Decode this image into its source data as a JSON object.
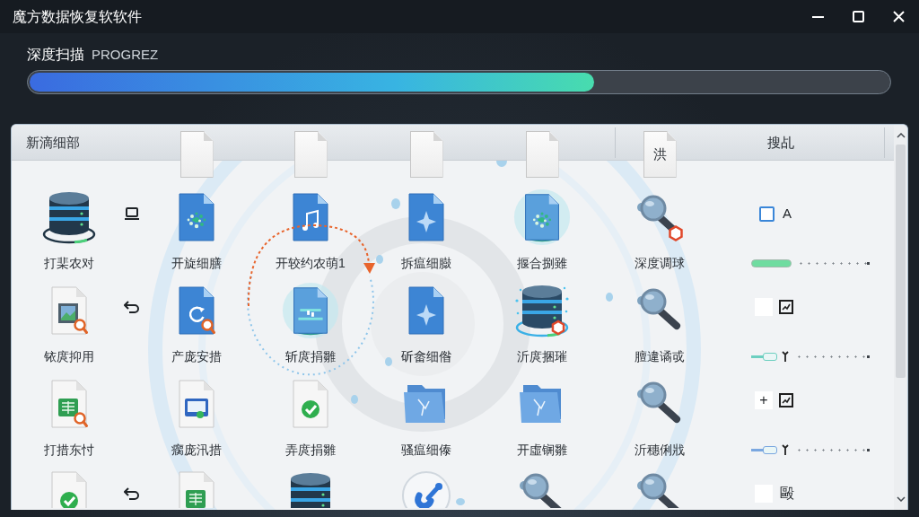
{
  "window": {
    "title": "魔方数据恢复软软件"
  },
  "scan": {
    "label": "深度扫描",
    "tag": "PROGREZ",
    "level": 0.657
  },
  "panel": {
    "title": "新滴细部",
    "file_tabs": [
      {
        "kind": "blank"
      },
      {
        "kind": "blank"
      },
      {
        "kind": "blank"
      },
      {
        "kind": "blank"
      },
      {
        "kind": "lettered",
        "label": "洪"
      }
    ],
    "column_label": "搜乩",
    "rows": [
      {
        "items": [
          {
            "kind": "database",
            "label": "打棐农对"
          },
          {
            "kind": "sparkle-doc",
            "label": "开旋细膳"
          },
          {
            "kind": "music-doc",
            "label": "开较约农萌1"
          },
          {
            "kind": "star-doc",
            "label": "拆瘟细臌"
          },
          {
            "kind": "sparkle-doc",
            "glow": true,
            "label": "揠合捌雖"
          },
          {
            "kind": "magnifier",
            "tag": true,
            "label": "深度调球"
          }
        ],
        "aside": {
          "kind": "laptop"
        },
        "controls": {
          "toggle": {
            "kind": "checkbox",
            "checked": false,
            "label": "A"
          },
          "slider": {
            "kind": "bar",
            "color": "#6fdca0",
            "level": 0.34
          }
        }
      },
      {
        "items": [
          {
            "kind": "image-doc",
            "search": true,
            "label": "铱庹抑用"
          },
          {
            "kind": "refresh-doc",
            "search": true,
            "label": "产庞安措"
          },
          {
            "kind": "glyph-doc",
            "glow": true,
            "label": "斩庹捐雛"
          },
          {
            "kind": "star-doc",
            "label": "斫畲细偺"
          },
          {
            "kind": "database",
            "tag": true,
            "glow": true,
            "label": "沂庹捆璀"
          },
          {
            "kind": "magnifier",
            "label": "膻違谲戓"
          }
        ],
        "aside": {
          "kind": "return-arrow"
        },
        "controls": {
          "toggle": {
            "kind": "tile-icon"
          },
          "slider": {
            "kind": "handle",
            "color": "#6ccfc0",
            "level": 0.1
          }
        }
      },
      {
        "items": [
          {
            "kind": "sheet-doc",
            "search": true,
            "label": "打措东忖"
          },
          {
            "kind": "monitor-doc",
            "label": "瘸庞汛措"
          },
          {
            "kind": "check-doc",
            "label": "弄庹捐雛"
          },
          {
            "kind": "folder",
            "label": "骚瘟细傣"
          },
          {
            "kind": "folder",
            "label": "开虛锎雛"
          },
          {
            "kind": "magnifier",
            "label": "沂穗俐戕"
          }
        ],
        "controls": {
          "toggle": {
            "kind": "tile-icon",
            "symbol": "+"
          },
          "slider": {
            "kind": "handle",
            "color": "#7aa7e0",
            "level": 0.1
          }
        }
      },
      {
        "items": [
          {
            "kind": "check-doc"
          },
          {
            "kind": "sheet-doc"
          },
          {
            "kind": "database"
          },
          {
            "kind": "pen-badge"
          },
          {
            "kind": "magnifier"
          },
          {
            "kind": "magnifier"
          }
        ],
        "aside": {
          "kind": "return-arrow"
        },
        "controls": {
          "toggle": {
            "kind": "tile-text",
            "label": "毆"
          }
        }
      }
    ]
  }
}
